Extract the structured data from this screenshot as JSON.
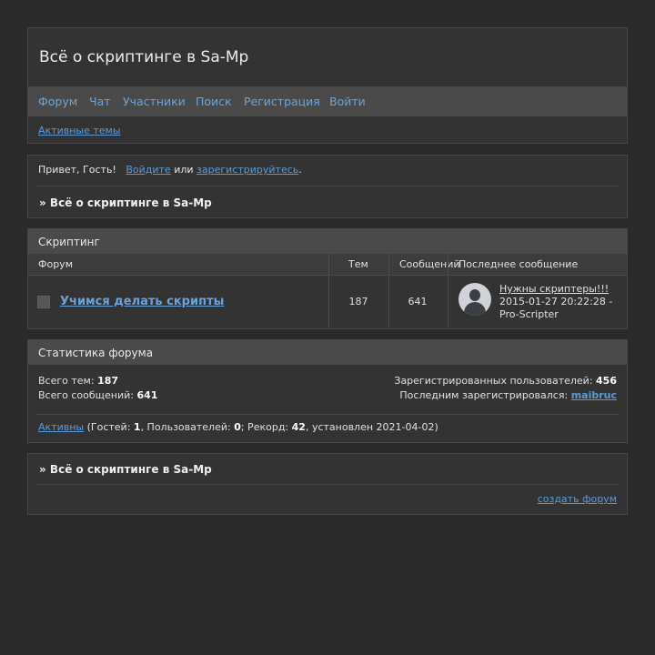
{
  "site": {
    "title": "Всё о скриптинге в Sa-Mp"
  },
  "nav": {
    "items": [
      "Форум",
      "Чат",
      "Участники",
      "Поиск",
      "Регистрация",
      "Войти"
    ],
    "active_topics": "Активные темы"
  },
  "welcome": {
    "greeting": "Привет, Гость!",
    "login": "Войдите",
    "or": "или",
    "register": "зарегистрируйтесь",
    "dot": ".",
    "crumb": "» Всё о скриптинге в Sa-Mp"
  },
  "category": {
    "name": "Скриптинг",
    "columns": {
      "forum": "Форум",
      "topics": "Тем",
      "posts": "Сообщений",
      "last": "Последнее сообщение"
    },
    "rows": [
      {
        "name": "Учимся делать скрипты",
        "topics": "187",
        "posts": "641",
        "last_title": "Нужны скриптеры!!!",
        "last_date": "2015-01-27 20:22:28 -",
        "last_author": "Pro-Scripter"
      }
    ]
  },
  "stats": {
    "title": "Статистика форума",
    "total_topics_label": "Всего тем:",
    "total_topics": "187",
    "total_posts_label": "Всего сообщений:",
    "total_posts": "641",
    "registered_label": "Зарегистрированных пользователей:",
    "registered": "456",
    "last_registered_label": "Последним зарегистрировался:",
    "last_registered": "maibruc",
    "active_link": "Активны",
    "guests_label": "(Гостей:",
    "guests": "1",
    "users_label": ", Пользователей:",
    "users": "0",
    "record_label": "; Рекорд:",
    "record": "42",
    "record_date": ", установлен 2021-04-02)"
  },
  "footer": {
    "crumb": "» Всё о скриптинге в Sa-Mp",
    "create": "создать форум"
  }
}
